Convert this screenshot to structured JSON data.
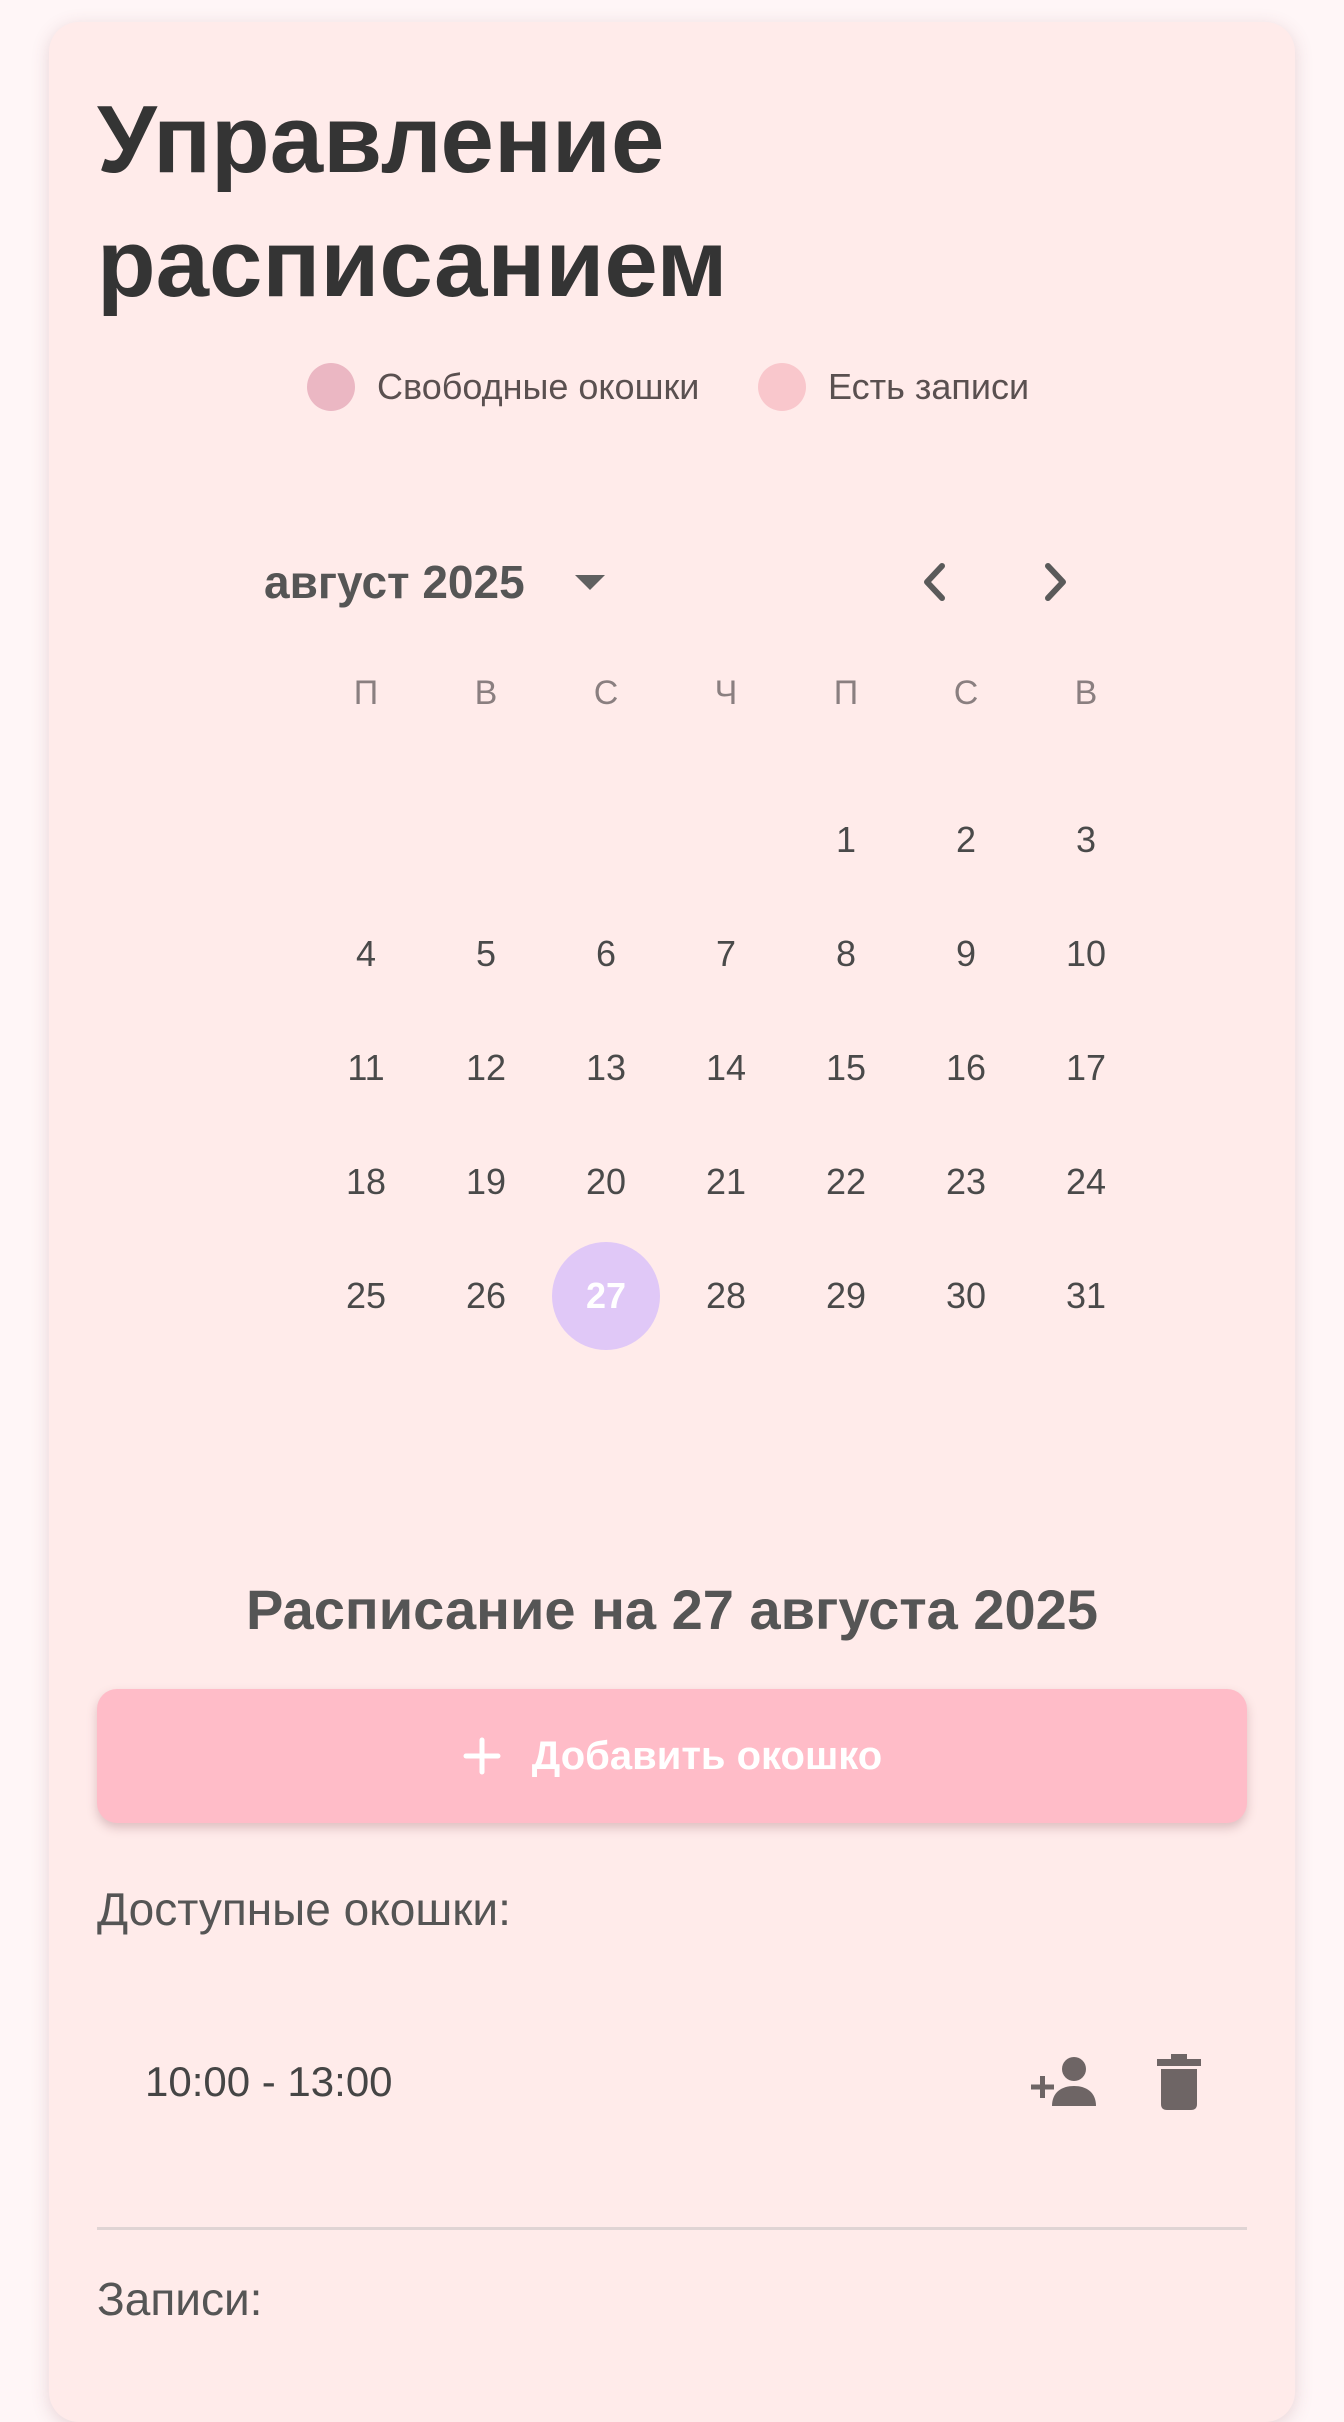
{
  "page": {
    "title": "Управление расписанием"
  },
  "legend": [
    {
      "label": "Свободные окошки",
      "color": "#ebb7c3"
    },
    {
      "label": "Есть записи",
      "color": "#f9c7cc"
    }
  ],
  "calendar": {
    "month_label": "август 2025",
    "weekdays": [
      "П",
      "В",
      "С",
      "Ч",
      "П",
      "С",
      "В"
    ],
    "weeks": [
      [
        "",
        "",
        "",
        "",
        "1",
        "2",
        "3"
      ],
      [
        "4",
        "5",
        "6",
        "7",
        "8",
        "9",
        "10"
      ],
      [
        "11",
        "12",
        "13",
        "14",
        "15",
        "16",
        "17"
      ],
      [
        "18",
        "19",
        "20",
        "21",
        "22",
        "23",
        "24"
      ],
      [
        "25",
        "26",
        "27",
        "28",
        "29",
        "30",
        "31"
      ]
    ],
    "selected_day": "27",
    "selected_color": "#e0c8f7"
  },
  "schedule": {
    "title": "Расписание на 27 августа 2025",
    "add_button_label": "Добавить окошко",
    "available_label": "Доступные окошки:",
    "slots": [
      {
        "time": "10:00 - 13:00"
      }
    ],
    "bookings_label": "Записи:"
  },
  "colors": {
    "card_bg": "#ffebea",
    "accent_button": "#ffbcc8"
  }
}
